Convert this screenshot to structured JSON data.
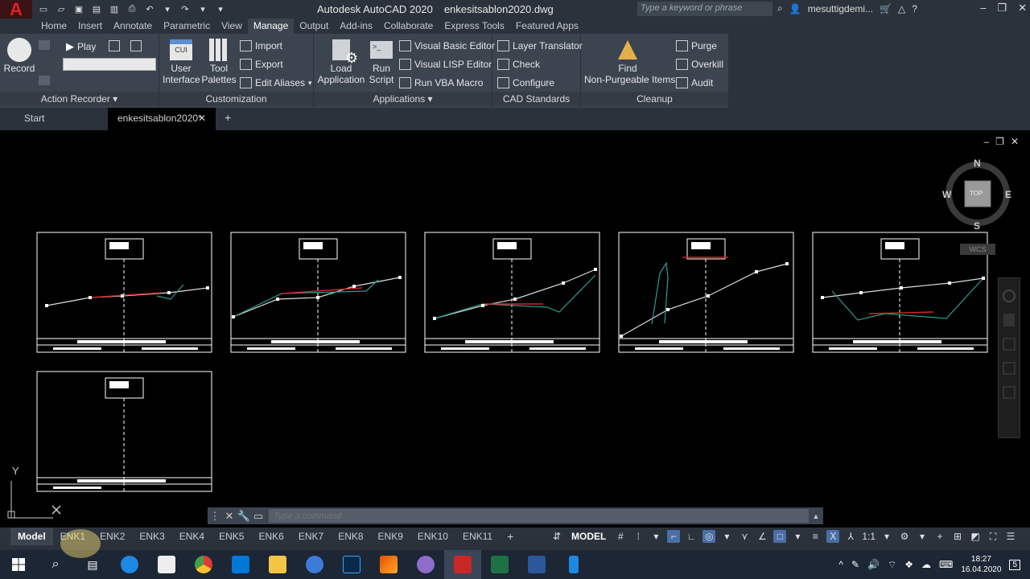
{
  "app": {
    "logo": "A",
    "name": "Autodesk AutoCAD 2020",
    "file": "enkesitsablon2020.dwg",
    "search_placeholder": "Type a keyword or phrase",
    "user": "mesuttigdemi..."
  },
  "ribbon_tabs": [
    "Home",
    "Insert",
    "Annotate",
    "Parametric",
    "View",
    "Manage",
    "Output",
    "Add-ins",
    "Collaborate",
    "Express Tools",
    "Featured Apps"
  ],
  "active_tab": "Manage",
  "panels": {
    "action_recorder": {
      "title": "Action Recorder",
      "record": "Record",
      "play": "Play"
    },
    "customization": {
      "title": "Customization",
      "cui": "CUI",
      "user_interface_1": "User",
      "user_interface_2": "Interface",
      "tool_palettes_1": "Tool",
      "tool_palettes_2": "Palettes",
      "import": "Import",
      "export": "Export",
      "edit_aliases": "Edit Aliases"
    },
    "applications": {
      "title": "Applications",
      "load_1": "Load",
      "load_2": "Application",
      "run_1": "Run",
      "run_2": "Script",
      "vbe": "Visual Basic Editor",
      "vlisp": "Visual LISP Editor",
      "vba": "Run VBA Macro"
    },
    "cad_standards": {
      "title": "CAD Standards",
      "layer_translator": "Layer Translator",
      "check": "Check",
      "configure": "Configure"
    },
    "cleanup": {
      "title": "Cleanup",
      "find_1": "Find",
      "find_2": "Non-Purgeable Items",
      "purge": "Purge",
      "overkill": "Overkill",
      "audit": "Audit"
    }
  },
  "doc_tabs": {
    "start": "Start",
    "current": "enkesitsablon2020*"
  },
  "viewcube": {
    "n": "N",
    "s": "S",
    "e": "E",
    "w": "W",
    "top": "TOP",
    "wcs": "WCS"
  },
  "ucs": {
    "y": "Y"
  },
  "command": {
    "placeholder": "Type a command"
  },
  "layout_tabs": [
    "Model",
    "ENK1",
    "ENK2",
    "ENK3",
    "ENK4",
    "ENK5",
    "ENK6",
    "ENK7",
    "ENK8",
    "ENK9",
    "ENK10",
    "ENK11"
  ],
  "status": {
    "model": "MODEL",
    "scale": "1:1"
  },
  "clock": {
    "time": "18:27",
    "date": "16.04.2020"
  },
  "notification_count": "5"
}
